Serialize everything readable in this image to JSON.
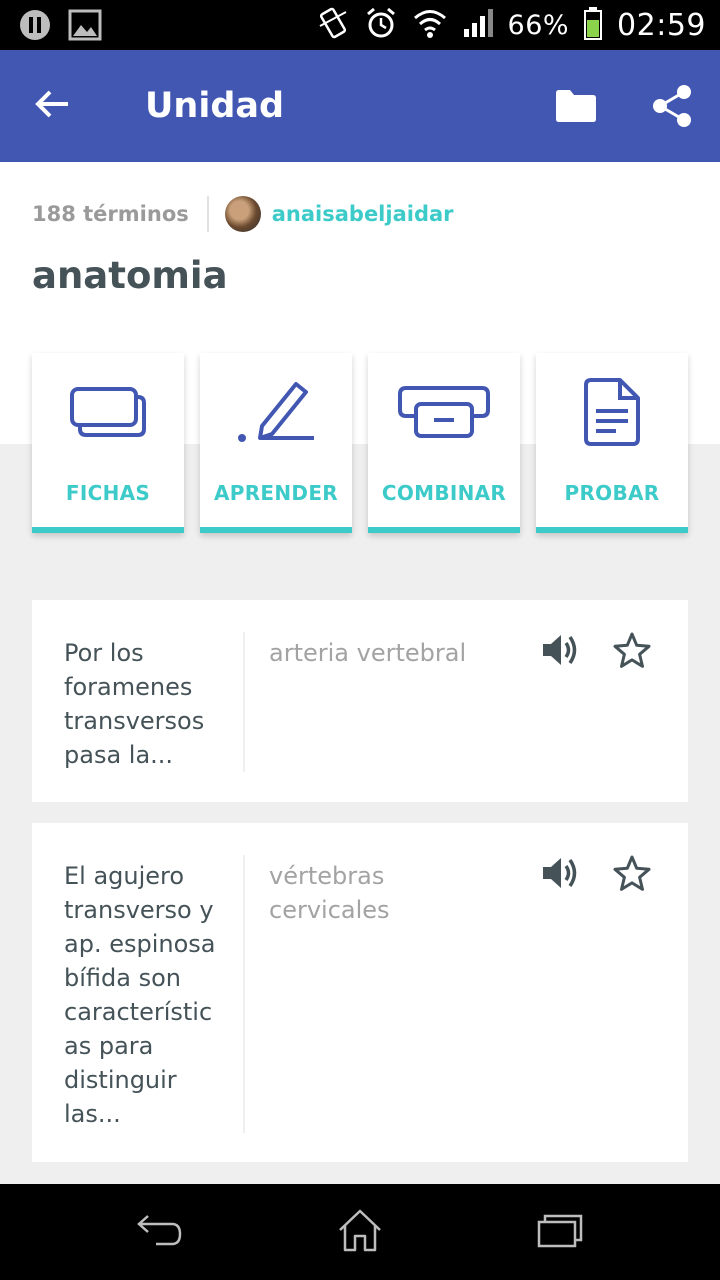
{
  "status_bar": {
    "battery_percent": "66%",
    "time": "02:59",
    "left_icons": [
      "pause-icon",
      "image-icon"
    ],
    "right_icons": [
      "vibrate-icon",
      "alarm-icon",
      "wifi-icon",
      "signal-icon",
      "battery-icon"
    ]
  },
  "app_bar": {
    "title": "Unidad",
    "background": "#4257b2",
    "icons": [
      "back-arrow-icon",
      "folder-icon",
      "share-icon"
    ]
  },
  "set": {
    "terms_count": "188 términos",
    "author": "anaisabeljaidar",
    "title": "anatomia"
  },
  "modes": [
    {
      "label": "FICHAS",
      "icon": "flashcards-icon"
    },
    {
      "label": "APRENDER",
      "icon": "learn-pen-icon"
    },
    {
      "label": "COMBINAR",
      "icon": "match-icon"
    },
    {
      "label": "PROBAR",
      "icon": "test-document-icon"
    }
  ],
  "accent_color": "#3ccbc9",
  "terms": [
    {
      "definition": "Por los foramenes transversos pasa la...",
      "term": "arteria vertebral"
    },
    {
      "definition": "El agujero transverso y ap. espinosa bífida son característic as para distinguir las...",
      "term": "vértebras cervicales"
    }
  ],
  "nav_bar": {
    "icons": [
      "nav-back-icon",
      "nav-home-icon",
      "nav-recents-icon"
    ]
  }
}
